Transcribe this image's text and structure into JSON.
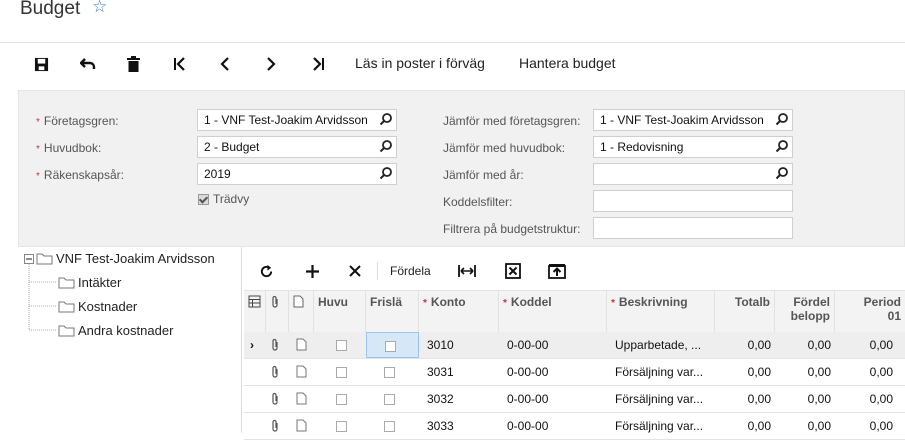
{
  "page": {
    "title": "Budget"
  },
  "toolbar": {
    "load_label": "Läs in poster i förväg",
    "manage_label": "Hantera budget"
  },
  "form": {
    "branch_label": "Företagsgren:",
    "branch_value": "1 - VNF Test-Joakim Arvidsson",
    "ledger_label": "Huvudbok:",
    "ledger_value": "2 - Budget",
    "year_label": "Räkenskapsår:",
    "year_value": "2019",
    "treeview_label": "Trädvy",
    "compare_branch_label": "Jämför med företagsgren:",
    "compare_branch_value": "1 - VNF Test-Joakim Arvidsson",
    "compare_ledger_label": "Jämför med huvudbok:",
    "compare_ledger_value": "1 - Redovisning",
    "compare_year_label": "Jämför med år:",
    "compare_year_value": "",
    "subaccount_filter_label": "Koddelsfilter:",
    "subaccount_filter_value": "",
    "structure_filter_label": "Filtrera på budgetstruktur:",
    "structure_filter_value": ""
  },
  "tree": {
    "root": "VNF Test-Joakim Arvidsson",
    "children": [
      "Intäkter",
      "Kostnader",
      "Andra kostnader"
    ]
  },
  "grid": {
    "distribute_label": "Fördela",
    "columns": {
      "main": "Huvu",
      "free": "Frislä",
      "account": "Konto",
      "subaccount": "Koddel",
      "description": "Beskrivning",
      "total": "Totalb",
      "distributed_1": "Fördel",
      "distributed_2": "belopp",
      "period_1": "Period",
      "period_2": "01"
    },
    "rows": [
      {
        "account": "3010",
        "sub": "0-00-00",
        "desc": "Upparbetade, ...",
        "total": "0,00",
        "dist": "0,00",
        "period": "0,00"
      },
      {
        "account": "3031",
        "sub": "0-00-00",
        "desc": "Försäljning var...",
        "total": "0,00",
        "dist": "0,00",
        "period": "0,00"
      },
      {
        "account": "3032",
        "sub": "0-00-00",
        "desc": "Försäljning var...",
        "total": "0,00",
        "dist": "0,00",
        "period": "0,00"
      },
      {
        "account": "3033",
        "sub": "0-00-00",
        "desc": "Försäljning var...",
        "total": "0,00",
        "dist": "0,00",
        "period": "0,00"
      }
    ]
  },
  "colors": {
    "accent": "#3b7bd6",
    "required": "#cc3333",
    "selected_row": "#eeeeee",
    "selected_cell": "#d6e8f8"
  }
}
